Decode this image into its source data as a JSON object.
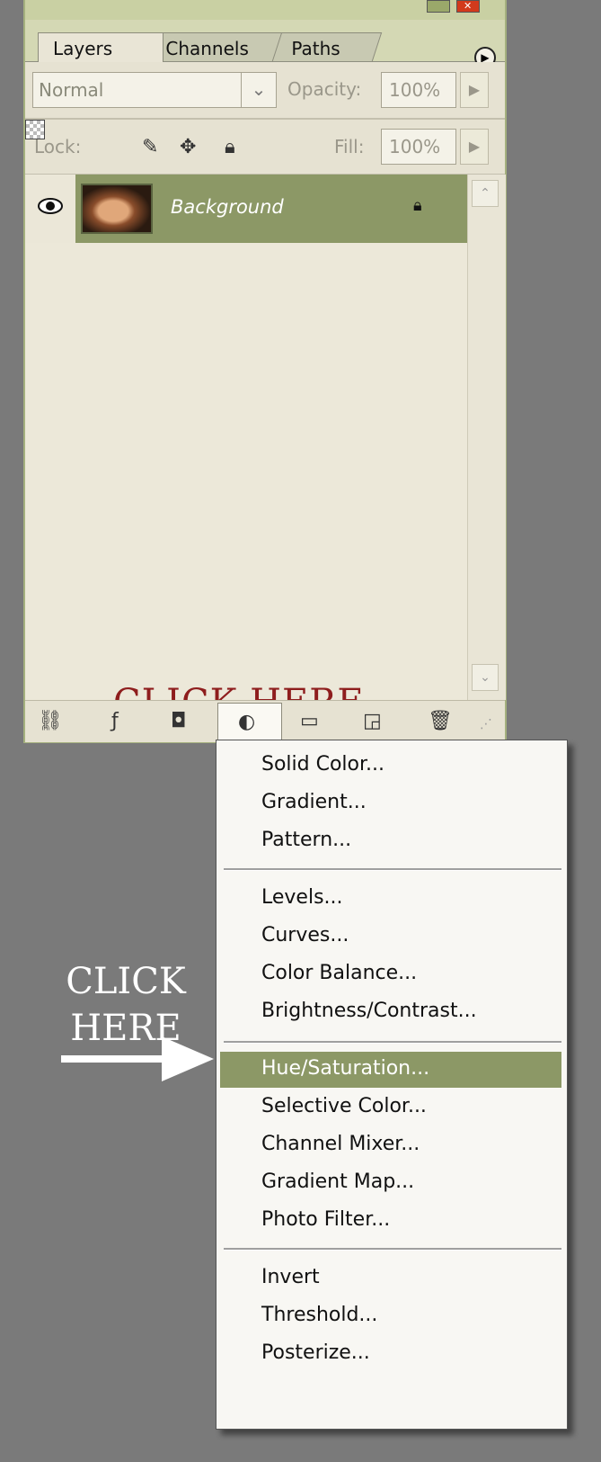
{
  "palette": {
    "tabs": [
      {
        "label": "Layers",
        "active": true
      },
      {
        "label": "Channels",
        "active": false
      },
      {
        "label": "Paths",
        "active": false
      }
    ],
    "blend_mode": "Normal",
    "opacity_label": "Opacity:",
    "opacity_value": "100%",
    "lock_label": "Lock:",
    "fill_label": "Fill:",
    "fill_value": "100%",
    "layers": [
      {
        "name": "Background",
        "visible": true,
        "locked": true
      }
    ],
    "colors": {
      "accent": "#8c9866",
      "panel": "#e9e5d6"
    }
  },
  "annotations": {
    "top": "CLICK HERE",
    "side_line1": "CLICK",
    "side_line2": "HERE",
    "top_color": "#8e1d1d"
  },
  "menu": {
    "groups": [
      [
        "Solid Color...",
        "Gradient...",
        "Pattern..."
      ],
      [
        "Levels...",
        "Curves...",
        "Color Balance...",
        "Brightness/Contrast..."
      ],
      [
        "Hue/Saturation...",
        "Selective Color...",
        "Channel Mixer...",
        "Gradient Map...",
        "Photo Filter..."
      ],
      [
        "Invert",
        "Threshold...",
        "Posterize..."
      ]
    ],
    "selected": "Hue/Saturation..."
  },
  "icons": [
    "link-icon",
    "layer-style-icon",
    "layer-mask-icon",
    "adjustment-layer-icon",
    "new-group-icon",
    "new-layer-icon",
    "trash-icon",
    "lock-icon",
    "eye-icon"
  ]
}
